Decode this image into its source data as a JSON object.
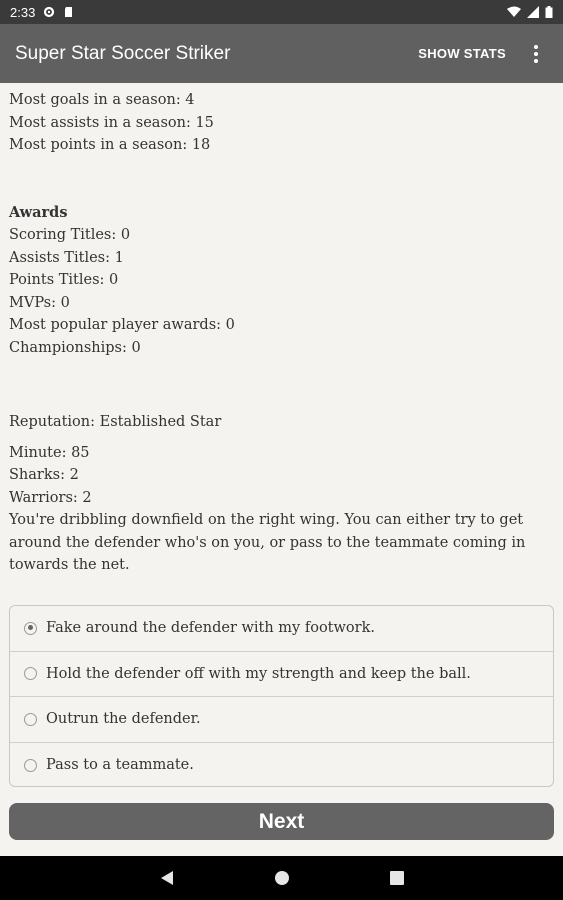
{
  "status_bar": {
    "time": "2:33"
  },
  "app_bar": {
    "title": "Super Star Soccer Striker",
    "show_stats": "SHOW STATS"
  },
  "records": {
    "goals": "Most goals in a season: 4",
    "assists": "Most assists in a season: 15",
    "points": "Most points in a season: 18"
  },
  "awards": {
    "heading": "Awards",
    "scoring": "Scoring Titles: 0",
    "assists": "Assists Titles: 1",
    "points": "Points Titles: 0",
    "mvps": "MVPs: 0",
    "popular": "Most popular player awards: 0",
    "championships": "Championships: 0"
  },
  "reputation": "Reputation: Established Star",
  "game": {
    "minute": "Minute: 85",
    "team1": "Sharks: 2",
    "team2": "Warriors: 2",
    "situation": "You're dribbling downfield on the right wing. You can either try to get around the defender who's on you, or pass to the teammate coming in towards the net."
  },
  "choices": [
    {
      "label": "Fake around the defender with my footwork.",
      "selected": true
    },
    {
      "label": "Hold the defender off with my strength and keep the ball.",
      "selected": false
    },
    {
      "label": "Outrun the defender.",
      "selected": false
    },
    {
      "label": "Pass to a teammate.",
      "selected": false
    }
  ],
  "next_button": "Next"
}
